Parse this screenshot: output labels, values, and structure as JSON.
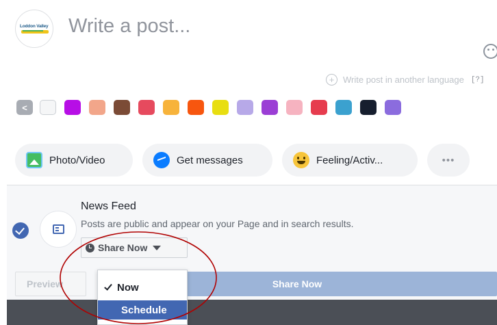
{
  "composer": {
    "avatar_text": "Loddon Valley",
    "placeholder": "Write a post...",
    "emoji_icon": "smiley-icon",
    "language_link": "Write post in another language",
    "help": "[?]"
  },
  "backgrounds": {
    "nav_icon": "chevron-left-icon",
    "swatch_colors": [
      "#f5f6f7",
      "#b70ee6",
      "#f2a68a",
      "#7b4b36",
      "#e64a5e",
      "#f7b33b",
      "#f7560f",
      "#e8de11",
      "#b7a9e8",
      "#9b3ed5",
      "#f6b3c0",
      "#e63c4e",
      "#3ba1cf",
      "#161e2e",
      "#8b6cde"
    ]
  },
  "actions": [
    {
      "label": "Photo/Video",
      "icon": "photo-icon"
    },
    {
      "label": "Get messages",
      "icon": "messenger-icon"
    },
    {
      "label": "Feeling/Activ...",
      "icon": "feeling-icon"
    },
    {
      "label": "•••",
      "icon": "more-icon"
    }
  ],
  "audience": {
    "title": "News Feed",
    "description": "Posts are public and appear on your Page and in search results.",
    "share_label": "Share Now"
  },
  "footer": {
    "preview_label": "Preview",
    "share_now_label": "Share Now"
  },
  "dropdown": {
    "options": [
      "Now",
      "Schedule"
    ],
    "selected": "Now",
    "highlighted": "Schedule"
  },
  "colors": {
    "accent": "#4267b2",
    "annotation_circle": "#b00000"
  }
}
